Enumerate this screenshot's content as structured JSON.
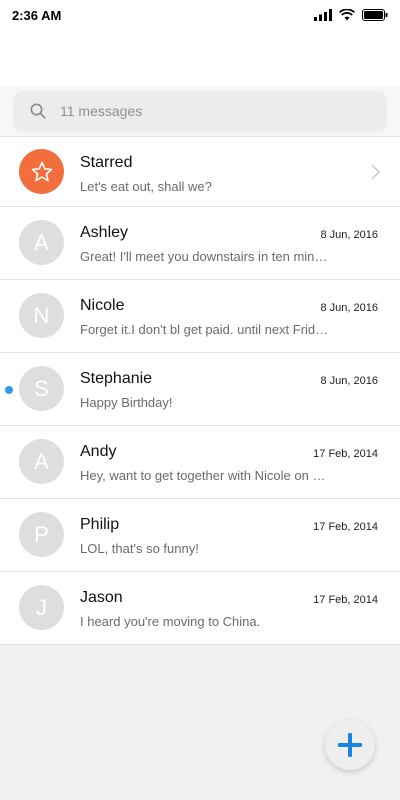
{
  "status_bar": {
    "time": "2:36 AM"
  },
  "search": {
    "placeholder": "11 messages"
  },
  "colors": {
    "starred": "#f26f3d",
    "unread": "#2e9bf0",
    "fab_plus": "#1a84e6"
  },
  "starred": {
    "title": "Starred",
    "preview": "Let's eat out, shall we?"
  },
  "conversations": [
    {
      "initial": "A",
      "name": "Ashley",
      "date": "8 Jun, 2016",
      "preview": "Great! I'll meet you downstairs in ten min…",
      "unread": false
    },
    {
      "initial": "N",
      "name": "Nicole",
      "date": "8 Jun, 2016",
      "preview": "Forget it.I don't bl get paid. until next Frid…",
      "unread": false
    },
    {
      "initial": "S",
      "name": "Stephanie",
      "date": "8 Jun, 2016",
      "preview": "Happy Birthday!",
      "unread": true
    },
    {
      "initial": "A",
      "name": "Andy",
      "date": "17 Feb, 2014",
      "preview": "Hey, want to get together with Nicole on …",
      "unread": false
    },
    {
      "initial": "P",
      "name": "Philip",
      "date": "17 Feb, 2014",
      "preview": "LOL, that's so funny!",
      "unread": false
    },
    {
      "initial": "J",
      "name": "Jason",
      "date": "17 Feb, 2014",
      "preview": "I heard you're moving to China.",
      "unread": false
    }
  ]
}
